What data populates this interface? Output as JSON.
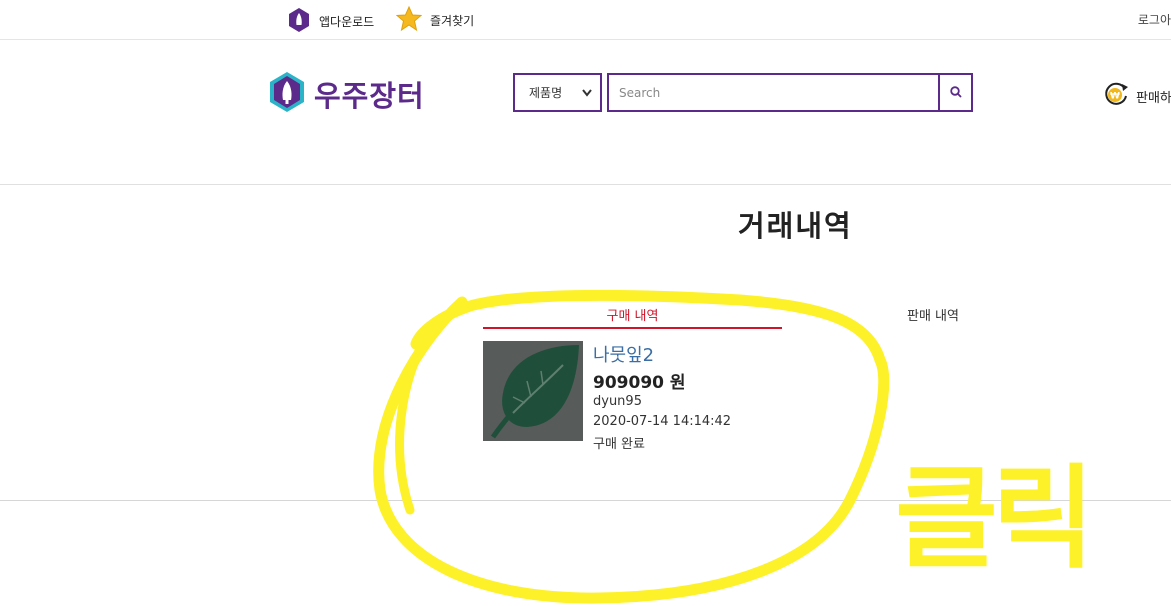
{
  "topbar": {
    "app_download": "앱다운로드",
    "favorites": "즐겨찾기",
    "login": "로그아"
  },
  "header": {
    "logo_text": "우주장터",
    "category_selected": "제품명",
    "search_placeholder": "Search",
    "sell_label": "판매하"
  },
  "page": {
    "title": "거래내역",
    "tabs": [
      "구매 내역",
      "판매 내역"
    ]
  },
  "transaction": {
    "name": "나뭇잎2",
    "price": "909090 원",
    "seller": "dyun95",
    "date": "2020-07-14 14:14:42",
    "status": "구매 완료"
  },
  "annotation": {
    "handwriting": "클릭",
    "color": "#fdf12a"
  },
  "colors": {
    "brand": "#5b2a8a",
    "active_tab": "#d0142a",
    "link": "#3a6ea5"
  }
}
